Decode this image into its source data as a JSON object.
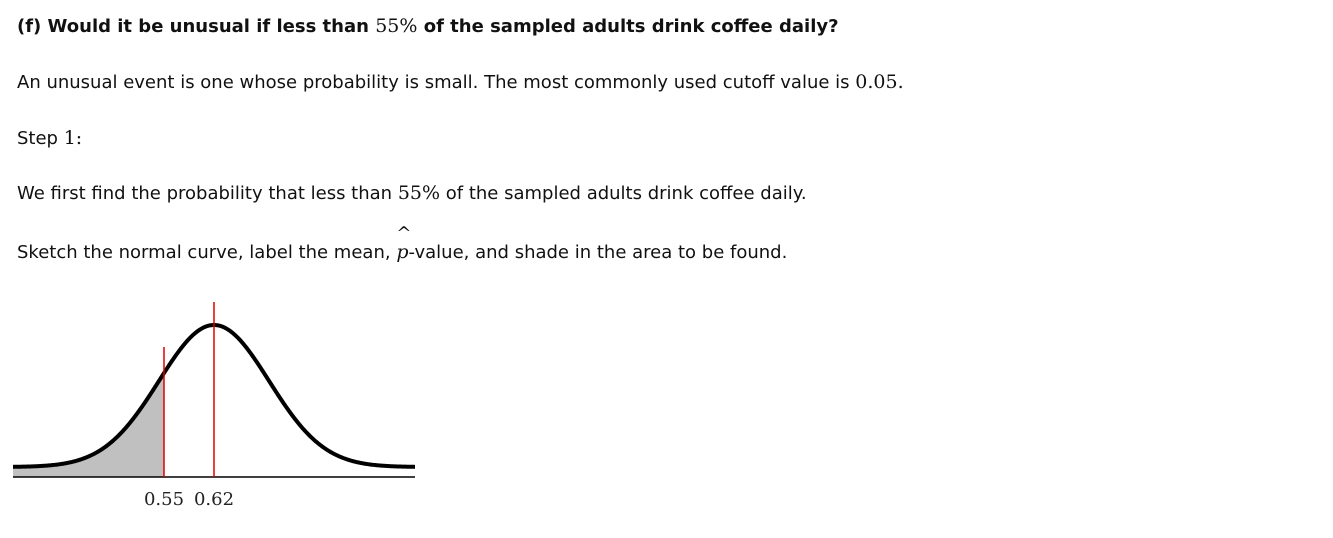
{
  "question": {
    "prefix": "(f) Would it be unusual if less than ",
    "percent": "55%",
    "suffix": " of the sampled adults drink coffee daily?"
  },
  "definition": {
    "text": "An unusual event is one whose probability is small. The most commonly used cutoff value is ",
    "value": "0.05",
    "end": "."
  },
  "step": {
    "label": "Step ",
    "number": "1:"
  },
  "find": {
    "prefix": "We first find the probability that less than ",
    "percent": "55%",
    "suffix": " of the sampled adults drink coffee daily."
  },
  "sketch": {
    "prefix": "Sketch the normal curve, label the mean, ",
    "symbol": "p",
    "hat": "^",
    "suffix": "-value, and shade in the area to be found."
  },
  "curve": {
    "mean": 0.62,
    "p_value": 0.55,
    "labels": [
      "0.55",
      "0.62"
    ],
    "shade_side": "left",
    "colors": {
      "curve": "#000000",
      "shade": "#c0c0c0",
      "markers": "#dd0000",
      "axis": "#000000"
    }
  }
}
